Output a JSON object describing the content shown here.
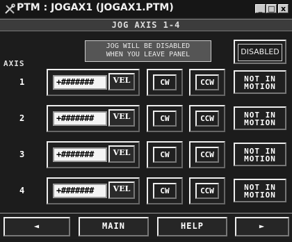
{
  "window": {
    "title": "PTM : JOGAX1 (JOGAX1.PTM)",
    "minimize_glyph": "_",
    "restore_glyph": "□",
    "close_glyph": "x"
  },
  "panel": {
    "title": "JOG AXIS 1-4"
  },
  "warning": {
    "line1": "JOG WILL BE DISABLED",
    "line2": "WHEN YOU LEAVE PANEL"
  },
  "disabled_button": {
    "label": "DISABLED"
  },
  "axis_header": "AXIS",
  "axes": [
    {
      "number": "1",
      "velocity": "+#######",
      "vel_label": "VEL",
      "cw_label": "CW",
      "ccw_label": "CCW",
      "status_line1": "NOT IN",
      "status_line2": "MOTION"
    },
    {
      "number": "2",
      "velocity": "+#######",
      "vel_label": "VEL",
      "cw_label": "CW",
      "ccw_label": "CCW",
      "status_line1": "NOT IN",
      "status_line2": "MOTION"
    },
    {
      "number": "3",
      "velocity": "+#######",
      "vel_label": "VEL",
      "cw_label": "CW",
      "ccw_label": "CCW",
      "status_line1": "NOT IN",
      "status_line2": "MOTION"
    },
    {
      "number": "4",
      "velocity": "+#######",
      "vel_label": "VEL",
      "cw_label": "CW",
      "ccw_label": "CCW",
      "status_line1": "NOT IN",
      "status_line2": "MOTION"
    }
  ],
  "nav": {
    "prev_glyph": "◄",
    "main_label": "MAIN",
    "help_label": "HELP",
    "next_glyph": "►"
  }
}
